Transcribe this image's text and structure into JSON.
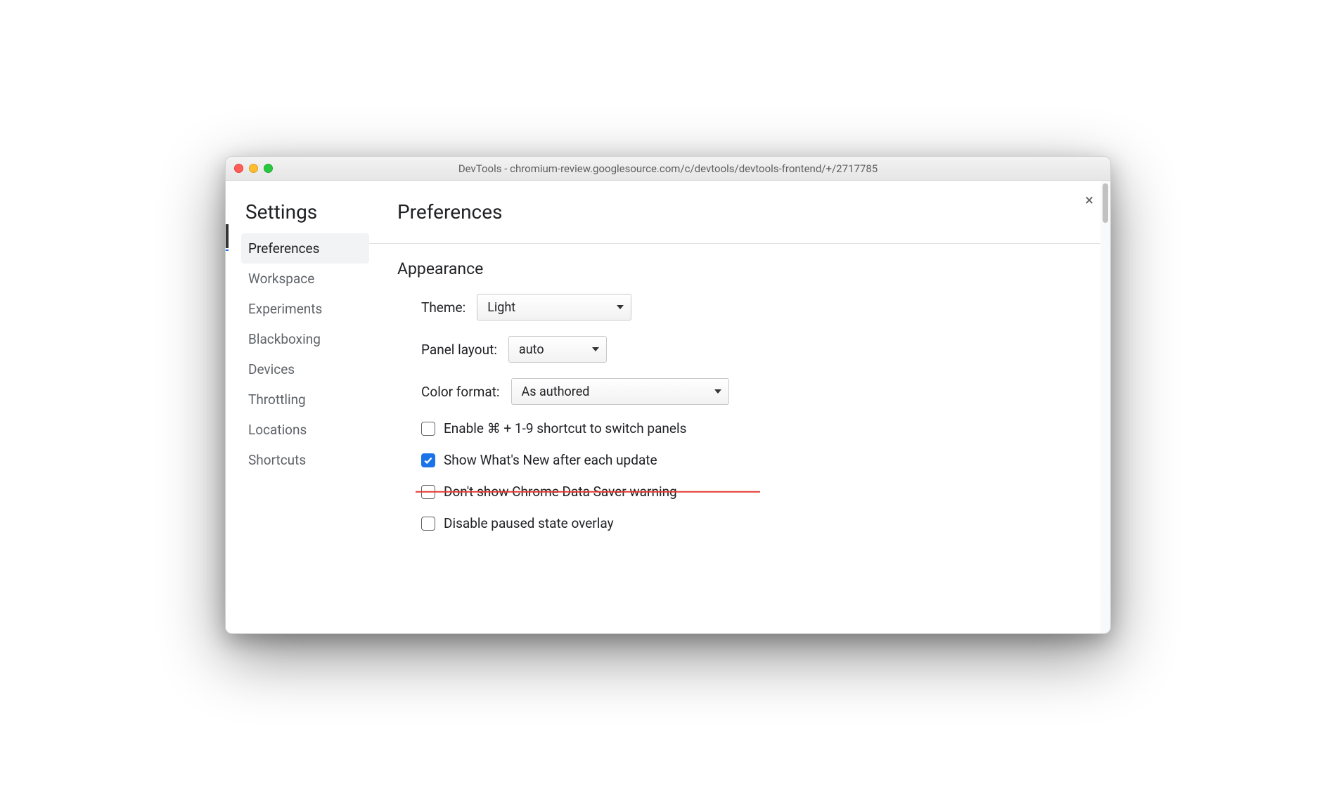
{
  "window": {
    "title": "DevTools - chromium-review.googlesource.com/c/devtools/devtools-frontend/+/2717785"
  },
  "sidebar": {
    "title": "Settings",
    "items": [
      {
        "label": "Preferences",
        "active": true
      },
      {
        "label": "Workspace",
        "active": false
      },
      {
        "label": "Experiments",
        "active": false
      },
      {
        "label": "Blackboxing",
        "active": false
      },
      {
        "label": "Devices",
        "active": false
      },
      {
        "label": "Throttling",
        "active": false
      },
      {
        "label": "Locations",
        "active": false
      },
      {
        "label": "Shortcuts",
        "active": false
      }
    ]
  },
  "main": {
    "title": "Preferences",
    "close_label": "×",
    "appearance": {
      "section_title": "Appearance",
      "theme_label": "Theme:",
      "theme_value": "Light",
      "panel_layout_label": "Panel layout:",
      "panel_layout_value": "auto",
      "color_format_label": "Color format:",
      "color_format_value": "As authored",
      "checkboxes": [
        {
          "label": "Enable ⌘ + 1-9 shortcut to switch panels",
          "checked": false,
          "strike": false
        },
        {
          "label": "Show What's New after each update",
          "checked": true,
          "strike": false
        },
        {
          "label": "Don't show Chrome Data Saver warning",
          "checked": false,
          "strike": true
        },
        {
          "label": "Disable paused state overlay",
          "checked": false,
          "strike": false
        }
      ]
    }
  }
}
